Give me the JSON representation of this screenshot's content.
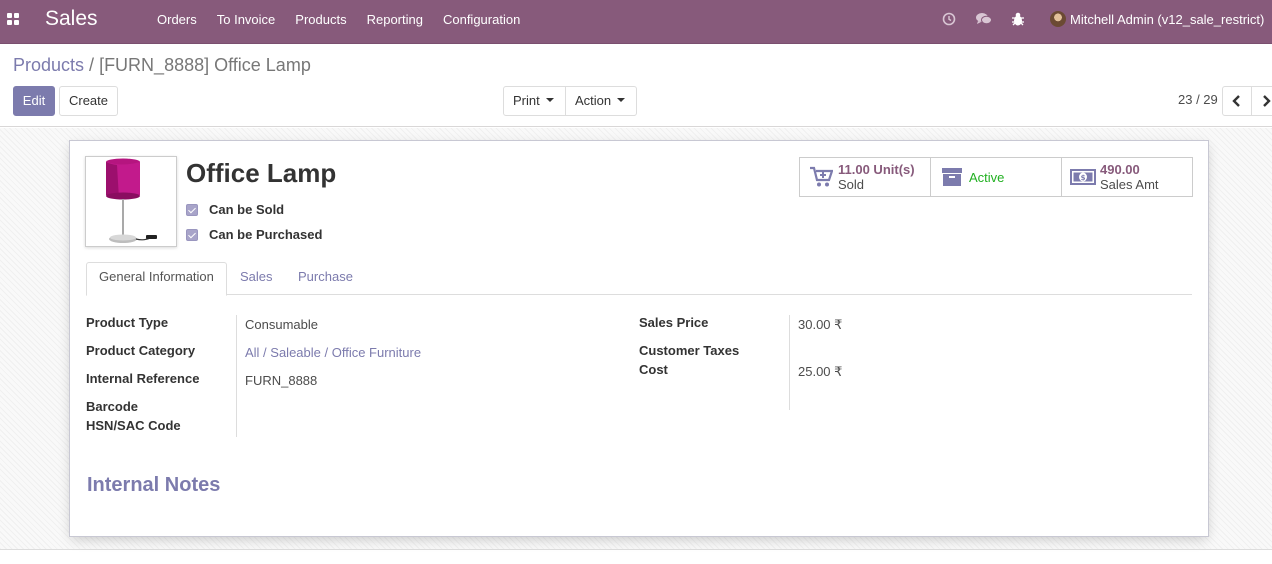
{
  "navbar": {
    "app_title": "Sales",
    "menu": [
      "Orders",
      "To Invoice",
      "Products",
      "Reporting",
      "Configuration"
    ],
    "user_name": "Mitchell Admin (v12_sale_restrict)",
    "icons": [
      "apps-grid-icon",
      "clock-icon",
      "chat-icon",
      "bug-icon"
    ]
  },
  "breadcrumb": {
    "parent": "Products",
    "separator": "/",
    "current": "[FURN_8888] Office Lamp"
  },
  "toolbar": {
    "edit_label": "Edit",
    "create_label": "Create",
    "print_label": "Print",
    "action_label": "Action"
  },
  "pager": {
    "value": "23 / 29"
  },
  "product": {
    "name": "Office Lamp",
    "can_be_sold_label": "Can be Sold",
    "can_be_sold": true,
    "can_be_purchased_label": "Can be Purchased",
    "can_be_purchased": true
  },
  "smart_buttons": {
    "sold_value": "11.00 Unit(s)",
    "sold_label": "Sold",
    "active_label": "Active",
    "sales_value": "490.00",
    "sales_label": "Sales Amt"
  },
  "tabs": [
    "General Information",
    "Sales",
    "Purchase"
  ],
  "fields_left": [
    {
      "label": "Product Type",
      "value": "Consumable"
    },
    {
      "label": "Product Category",
      "value": "All / Saleable / Office Furniture"
    },
    {
      "label": "Internal Reference",
      "value": "FURN_8888"
    },
    {
      "label": "Barcode",
      "value": ""
    },
    {
      "label": "HSN/SAC Code",
      "value": ""
    }
  ],
  "fields_right": [
    {
      "label": "Sales Price",
      "value": "30.00 ₹"
    },
    {
      "label": "Customer Taxes",
      "value": ""
    },
    {
      "label": "Cost",
      "value": "25.00 ₹"
    }
  ],
  "notes": {
    "title": "Internal Notes"
  },
  "colors": {
    "brand": "#875A7B",
    "primary": "#7C7BAD",
    "active_green": "#21b021"
  }
}
